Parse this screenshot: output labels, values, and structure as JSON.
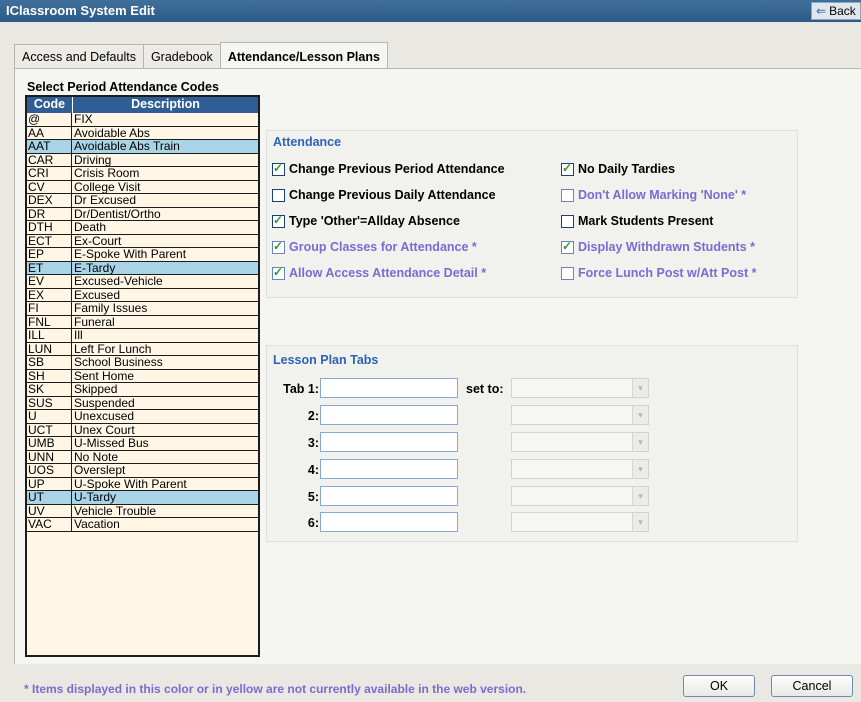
{
  "window": {
    "title": "IClassroom System Edit",
    "back_label": "Back",
    "back_icon": "left-arrow-icon"
  },
  "tabs": [
    {
      "label": "Access and Defaults",
      "active": false
    },
    {
      "label": "Gradebook",
      "active": false
    },
    {
      "label": "Attendance/Lesson Plans",
      "active": true
    }
  ],
  "codes": {
    "title": "Select Period Attendance Codes",
    "headers": {
      "code": "Code",
      "description": "Description"
    },
    "rows": [
      {
        "code": "@",
        "description": "FIX",
        "selected": false
      },
      {
        "code": "AA",
        "description": "Avoidable Abs",
        "selected": false
      },
      {
        "code": "AAT",
        "description": "Avoidable Abs Train",
        "selected": true
      },
      {
        "code": "CAR",
        "description": "Driving",
        "selected": false
      },
      {
        "code": "CRI",
        "description": "Crisis Room",
        "selected": false
      },
      {
        "code": "CV",
        "description": "College Visit",
        "selected": false
      },
      {
        "code": "DEX",
        "description": "Dr Excused",
        "selected": false
      },
      {
        "code": "DR",
        "description": "Dr/Dentist/Ortho",
        "selected": false
      },
      {
        "code": "DTH",
        "description": "Death",
        "selected": false
      },
      {
        "code": "ECT",
        "description": "Ex-Court",
        "selected": false
      },
      {
        "code": "EP",
        "description": "E-Spoke With Parent",
        "selected": false
      },
      {
        "code": "ET",
        "description": "E-Tardy",
        "selected": true
      },
      {
        "code": "EV",
        "description": "Excused-Vehicle",
        "selected": false
      },
      {
        "code": "EX",
        "description": "Excused",
        "selected": false
      },
      {
        "code": "FI",
        "description": "Family Issues",
        "selected": false
      },
      {
        "code": "FNL",
        "description": "Funeral",
        "selected": false
      },
      {
        "code": "ILL",
        "description": "Ill",
        "selected": false
      },
      {
        "code": "LUN",
        "description": "Left For Lunch",
        "selected": false
      },
      {
        "code": "SB",
        "description": "School Business",
        "selected": false
      },
      {
        "code": "SH",
        "description": "Sent Home",
        "selected": false
      },
      {
        "code": "SK",
        "description": "Skipped",
        "selected": false
      },
      {
        "code": "SUS",
        "description": "Suspended",
        "selected": false
      },
      {
        "code": "U",
        "description": "Unexcused",
        "selected": false
      },
      {
        "code": "UCT",
        "description": "Unex Court",
        "selected": false
      },
      {
        "code": "UMB",
        "description": "U-Missed Bus",
        "selected": false
      },
      {
        "code": "UNN",
        "description": "No Note",
        "selected": false
      },
      {
        "code": "UOS",
        "description": "Overslept",
        "selected": false
      },
      {
        "code": "UP",
        "description": "U-Spoke With Parent",
        "selected": false
      },
      {
        "code": "UT",
        "description": "U-Tardy",
        "selected": true
      },
      {
        "code": "UV",
        "description": "Vehicle Trouble",
        "selected": false
      },
      {
        "code": "VAC",
        "description": "Vacation",
        "selected": false
      }
    ]
  },
  "attendance": {
    "title": "Attendance",
    "options": [
      {
        "id": "change-prev-period",
        "label": "Change Previous Period Attendance",
        "checked": true,
        "unavailable": false
      },
      {
        "id": "no-daily-tardies",
        "label": "No Daily Tardies",
        "checked": true,
        "unavailable": false
      },
      {
        "id": "change-prev-daily",
        "label": "Change Previous Daily Attendance",
        "checked": false,
        "unavailable": false
      },
      {
        "id": "dont-allow-none",
        "label": "Don't Allow Marking 'None' *",
        "checked": false,
        "unavailable": true
      },
      {
        "id": "type-other-allday",
        "label": "Type 'Other'=Allday Absence",
        "checked": true,
        "unavailable": false
      },
      {
        "id": "mark-present",
        "label": "Mark Students Present",
        "checked": false,
        "unavailable": false
      },
      {
        "id": "group-classes",
        "label": "Group Classes for Attendance *",
        "checked": true,
        "unavailable": true
      },
      {
        "id": "display-withdrawn",
        "label": "Display Withdrawn Students *",
        "checked": true,
        "unavailable": true
      },
      {
        "id": "allow-access-detail",
        "label": "Allow Access Attendance Detail *",
        "checked": true,
        "unavailable": true
      },
      {
        "id": "force-lunch-post",
        "label": "Force Lunch Post w/Att Post *",
        "checked": false,
        "unavailable": true
      }
    ]
  },
  "lesson_plans": {
    "title": "Lesson Plan Tabs",
    "set_to_label": "set to:",
    "tabs": [
      {
        "label": "Tab 1:",
        "value": "",
        "set_to": ""
      },
      {
        "label": "2:",
        "value": "",
        "set_to": ""
      },
      {
        "label": "3:",
        "value": "",
        "set_to": ""
      },
      {
        "label": "4:",
        "value": "",
        "set_to": ""
      },
      {
        "label": "5:",
        "value": "",
        "set_to": ""
      },
      {
        "label": "6:",
        "value": "",
        "set_to": ""
      }
    ]
  },
  "footer": {
    "note": "* Items displayed in this color or in yellow are not currently available in the web version.",
    "ok_label": "OK",
    "cancel_label": "Cancel"
  },
  "colors": {
    "title_bar": "#2d5a86",
    "selected_row": "#a9d4e8",
    "unavailable_text": "#7e6ad0",
    "section_title": "#2c63b5",
    "code_bg": "#fff6e6"
  }
}
